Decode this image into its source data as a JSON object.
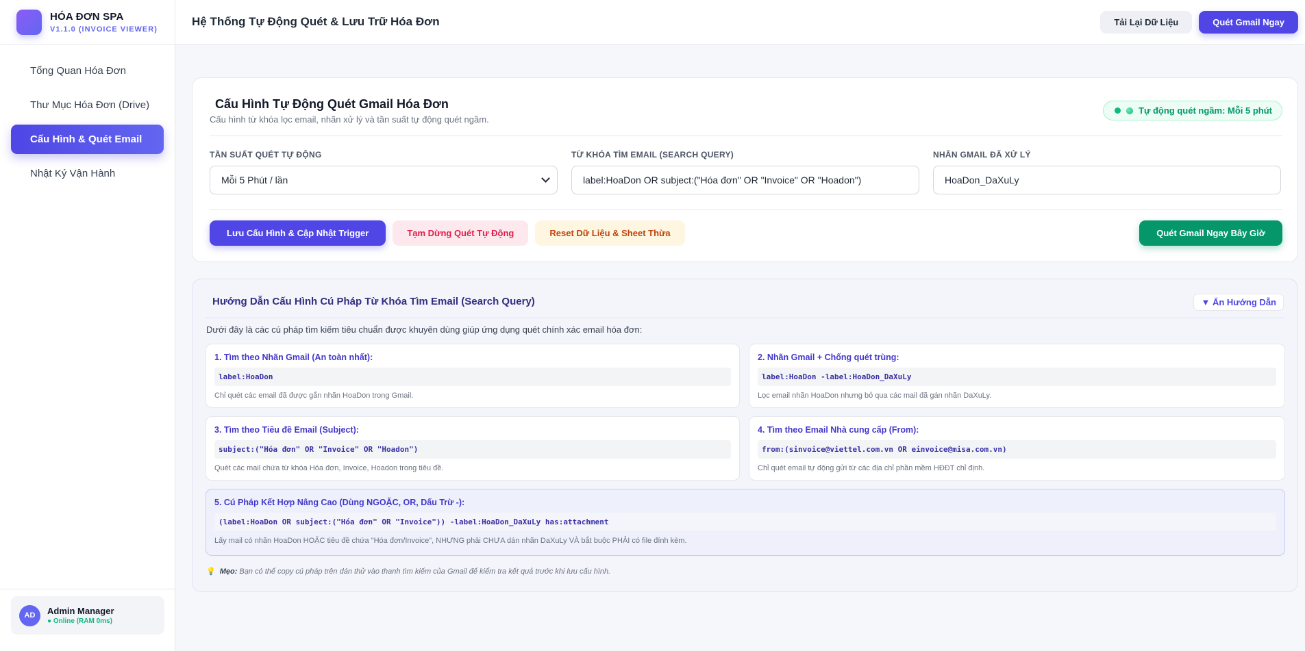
{
  "brand": {
    "name": "HÓA ĐƠN SPA",
    "version": "V1.1.0 (INVOICE VIEWER)"
  },
  "nav": [
    {
      "label": "Tổng Quan Hóa Đơn",
      "active": false
    },
    {
      "label": "Thư Mục Hóa Đơn (Drive)",
      "active": false
    },
    {
      "label": "Cấu Hình & Quét Email",
      "active": true
    },
    {
      "label": "Nhật Ký Vận Hành",
      "active": false
    }
  ],
  "user": {
    "initials": "AD",
    "name": "Admin Manager",
    "status": "● Online (RAM 0ms)"
  },
  "header": {
    "title": "Hệ Thống Tự Động Quét & Lưu Trữ Hóa Đơn",
    "reload_label": "Tải Lại Dữ Liệu",
    "scan_label": "Quét Gmail Ngay"
  },
  "config": {
    "title": "Cấu Hình Tự Động Quét Gmail Hóa Đơn",
    "subtitle": "Cấu hình từ khóa lọc email, nhãn xử lý và tần suất tự động quét ngầm.",
    "status_badge": "Tự động quét ngầm: Mỗi 5 phút",
    "frequency_label": "TẦN SUẤT QUÉT TỰ ĐỘNG",
    "frequency_value": "Mỗi 5 Phút / lần",
    "query_label": "TỪ KHÓA TÌM EMAIL (SEARCH QUERY)",
    "query_value": "label:HoaDon OR subject:(\"Hóa đơn\" OR \"Invoice\" OR \"Hoadon\")",
    "label_label": "NHÃN GMAIL ĐÃ XỬ LÝ",
    "label_value": "HoaDon_DaXuLy",
    "save_label": "Lưu Cấu Hình & Cập Nhật Trigger",
    "pause_label": "Tạm Dừng Quét Tự Động",
    "reset_label": "Reset Dữ Liệu & Sheet Thừa",
    "scan_now_label": "Quét Gmail Ngay Bây Giờ"
  },
  "guide": {
    "title": "Hướng Dẫn Cấu Hình Cú Pháp Từ Khóa Tìm Email (Search Query)",
    "hide_label": "▼ Ẩn Hướng Dẫn",
    "intro": "Dưới đây là các cú pháp tìm kiếm tiêu chuẩn được khuyên dùng giúp ứng dụng quét chính xác email hóa đơn:",
    "items": [
      {
        "title": "1. Tìm theo Nhãn Gmail (An toàn nhất):",
        "code": "label:HoaDon",
        "desc": "Chỉ quét các email đã được gắn nhãn HoaDon trong Gmail."
      },
      {
        "title": "2. Nhãn Gmail + Chống quét trùng:",
        "code": "label:HoaDon -label:HoaDon_DaXuLy",
        "desc": "Lọc email nhãn HoaDon nhưng bỏ qua các mail đã gán nhãn DaXuLy."
      },
      {
        "title": "3. Tìm theo Tiêu đề Email (Subject):",
        "code": "subject:(\"Hóa đơn\" OR \"Invoice\" OR \"Hoadon\")",
        "desc": "Quét các mail chứa từ khóa Hóa đơn, Invoice, Hoadon trong tiêu đề."
      },
      {
        "title": "4. Tìm theo Email Nhà cung cấp (From):",
        "code": "from:(sinvoice@viettel.com.vn OR einvoice@misa.com.vn)",
        "desc": "Chỉ quét email tự động gửi từ các địa chỉ phần mềm HĐĐT chỉ định."
      },
      {
        "title": "5. Cú Pháp Kết Hợp Nâng Cao (Dùng NGOẶC, OR, Dấu Trừ -):",
        "code": "(label:HoaDon OR subject:(\"Hóa đơn\" OR \"Invoice\")) -label:HoaDon_DaXuLy has:attachment",
        "desc": "Lấy mail có nhãn HoaDon HOẶC tiêu đề chứa \"Hóa đơn/Invoice\", NHƯNG phải CHƯA dán nhãn DaXuLy VÀ bắt buộc PHẢI có file đính kèm."
      }
    ],
    "tip_label": "Mẹo:",
    "tip_text": " Bạn có thể copy cú pháp trên dán thử vào thanh tìm kiếm của Gmail để kiểm tra kết quả trước khi lưu cấu hình."
  },
  "icons": {
    "logo": "app-logo-icon",
    "status_dot": "status-dot-icon",
    "tip": "lightbulb-icon"
  },
  "colors": {
    "accent": "#4f46e5",
    "success": "#059669",
    "danger": "#e11d48",
    "warning": "#c2410c"
  }
}
